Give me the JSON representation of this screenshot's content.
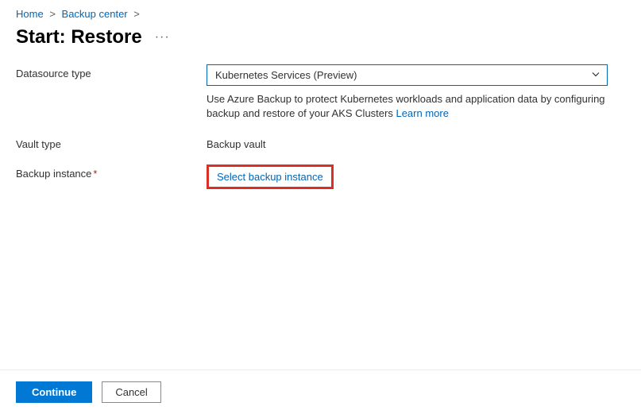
{
  "breadcrumb": {
    "items": [
      "Home",
      "Backup center"
    ],
    "separator": ">"
  },
  "page": {
    "title": "Start: Restore"
  },
  "form": {
    "datasource_type": {
      "label": "Datasource type",
      "value": "Kubernetes Services (Preview)",
      "help_prefix": "Use Azure Backup to protect Kubernetes workloads and application data by configuring backup and restore of your AKS Clusters ",
      "learn_more": "Learn more"
    },
    "vault_type": {
      "label": "Vault type",
      "value": "Backup vault"
    },
    "backup_instance": {
      "label": "Backup instance",
      "required": "*",
      "link_text": "Select backup instance"
    }
  },
  "footer": {
    "continue": "Continue",
    "cancel": "Cancel"
  }
}
